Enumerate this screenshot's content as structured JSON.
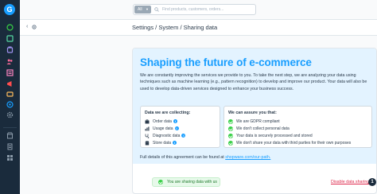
{
  "search": {
    "scope": "All",
    "placeholder": "Find products, customers, orders..."
  },
  "breadcrumb": "Settings / System / Sharing data",
  "headline": "Shaping the future of e-commerce",
  "intro": "We are constantly improving the services we provide to you. To take the next step, we are analyzing your data using techniques such as machine learning (e.g., pattern recognition) to develop and improve our product. Your data will also be used to develop data-driven services designed to enhance your business success.",
  "collecting": {
    "title": "Data we are collecting:",
    "items": [
      {
        "label": "Order data",
        "icon": "shopping-bag-icon"
      },
      {
        "label": "Usage data",
        "icon": "chart-icon"
      },
      {
        "label": "Diagnostic data",
        "icon": "stethoscope-icon"
      },
      {
        "label": "Store data",
        "icon": "store-icon"
      }
    ]
  },
  "assurance": {
    "title": "We can assure you that:",
    "items": [
      "We are GDPR compliant",
      "We don't collect personal data",
      "Your data is securely processed and stored",
      "We don't share your data with third parties for their own purposes"
    ]
  },
  "details": {
    "text": "Full details of this agreement can be found at",
    "link": "shopware.com/our-path."
  },
  "status": "You are sharing data with us",
  "disable_link": "Disable data sharing",
  "help_badge": "1",
  "colors": {
    "accent": "#189eff",
    "sidebar": "#1a2b3c",
    "success": "#37d046",
    "danger": "#de294c"
  }
}
